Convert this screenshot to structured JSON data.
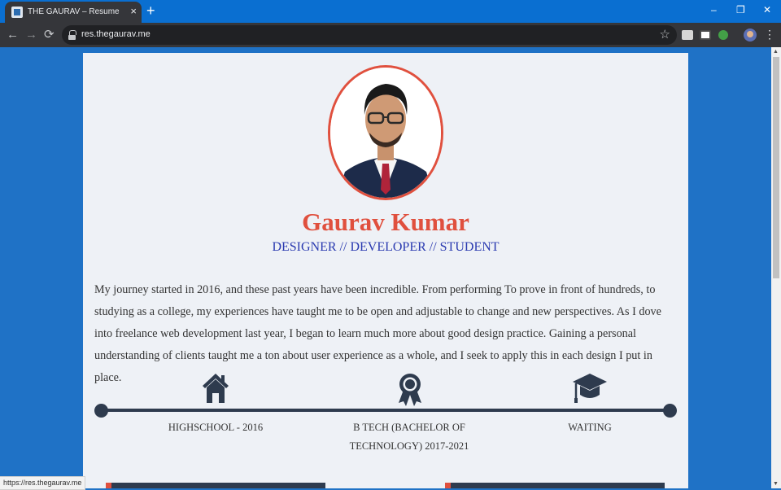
{
  "browser": {
    "tab_title": "THE GAURAV – Resume",
    "tab_close": "×",
    "new_tab": "+",
    "url": "res.thegaurav.me",
    "window_controls": {
      "minimize": "–",
      "restore": "❐",
      "close": "✕"
    },
    "nav": {
      "back": "←",
      "forward": "→",
      "reload": "⟳"
    },
    "star": "☆",
    "menu": "⋮",
    "status_url": "https://res.thegaurav.me"
  },
  "profile": {
    "name": "Gaurav Kumar",
    "roles": "DESIGNER // DEVELOPER // STUDENT",
    "bio": "My journey started in 2016, and these past years have been incredible. From performing To prove in front of hundreds, to studying as a college, my experiences have taught me to be open and adjustable to change and new perspectives. As I dove into freelance web development last year, I began to learn much more about good design practice. Gaining a personal understanding of clients taught me a ton about user experience as a whole, and I seek to apply this in each design I put in place."
  },
  "timeline": [
    {
      "icon": "home-icon",
      "label": "HIGHSCHOOL - 2016"
    },
    {
      "icon": "award-icon",
      "label": "B TECH (BACHELOR OF TECHNOLOGY) 2017-2021"
    },
    {
      "icon": "graduation-cap-icon",
      "label": "WAITING"
    }
  ],
  "colors": {
    "accent": "#e0503e",
    "navy": "#2e3b4e",
    "role_blue": "#2a3ab0",
    "page_bg": "#1f72c6"
  }
}
